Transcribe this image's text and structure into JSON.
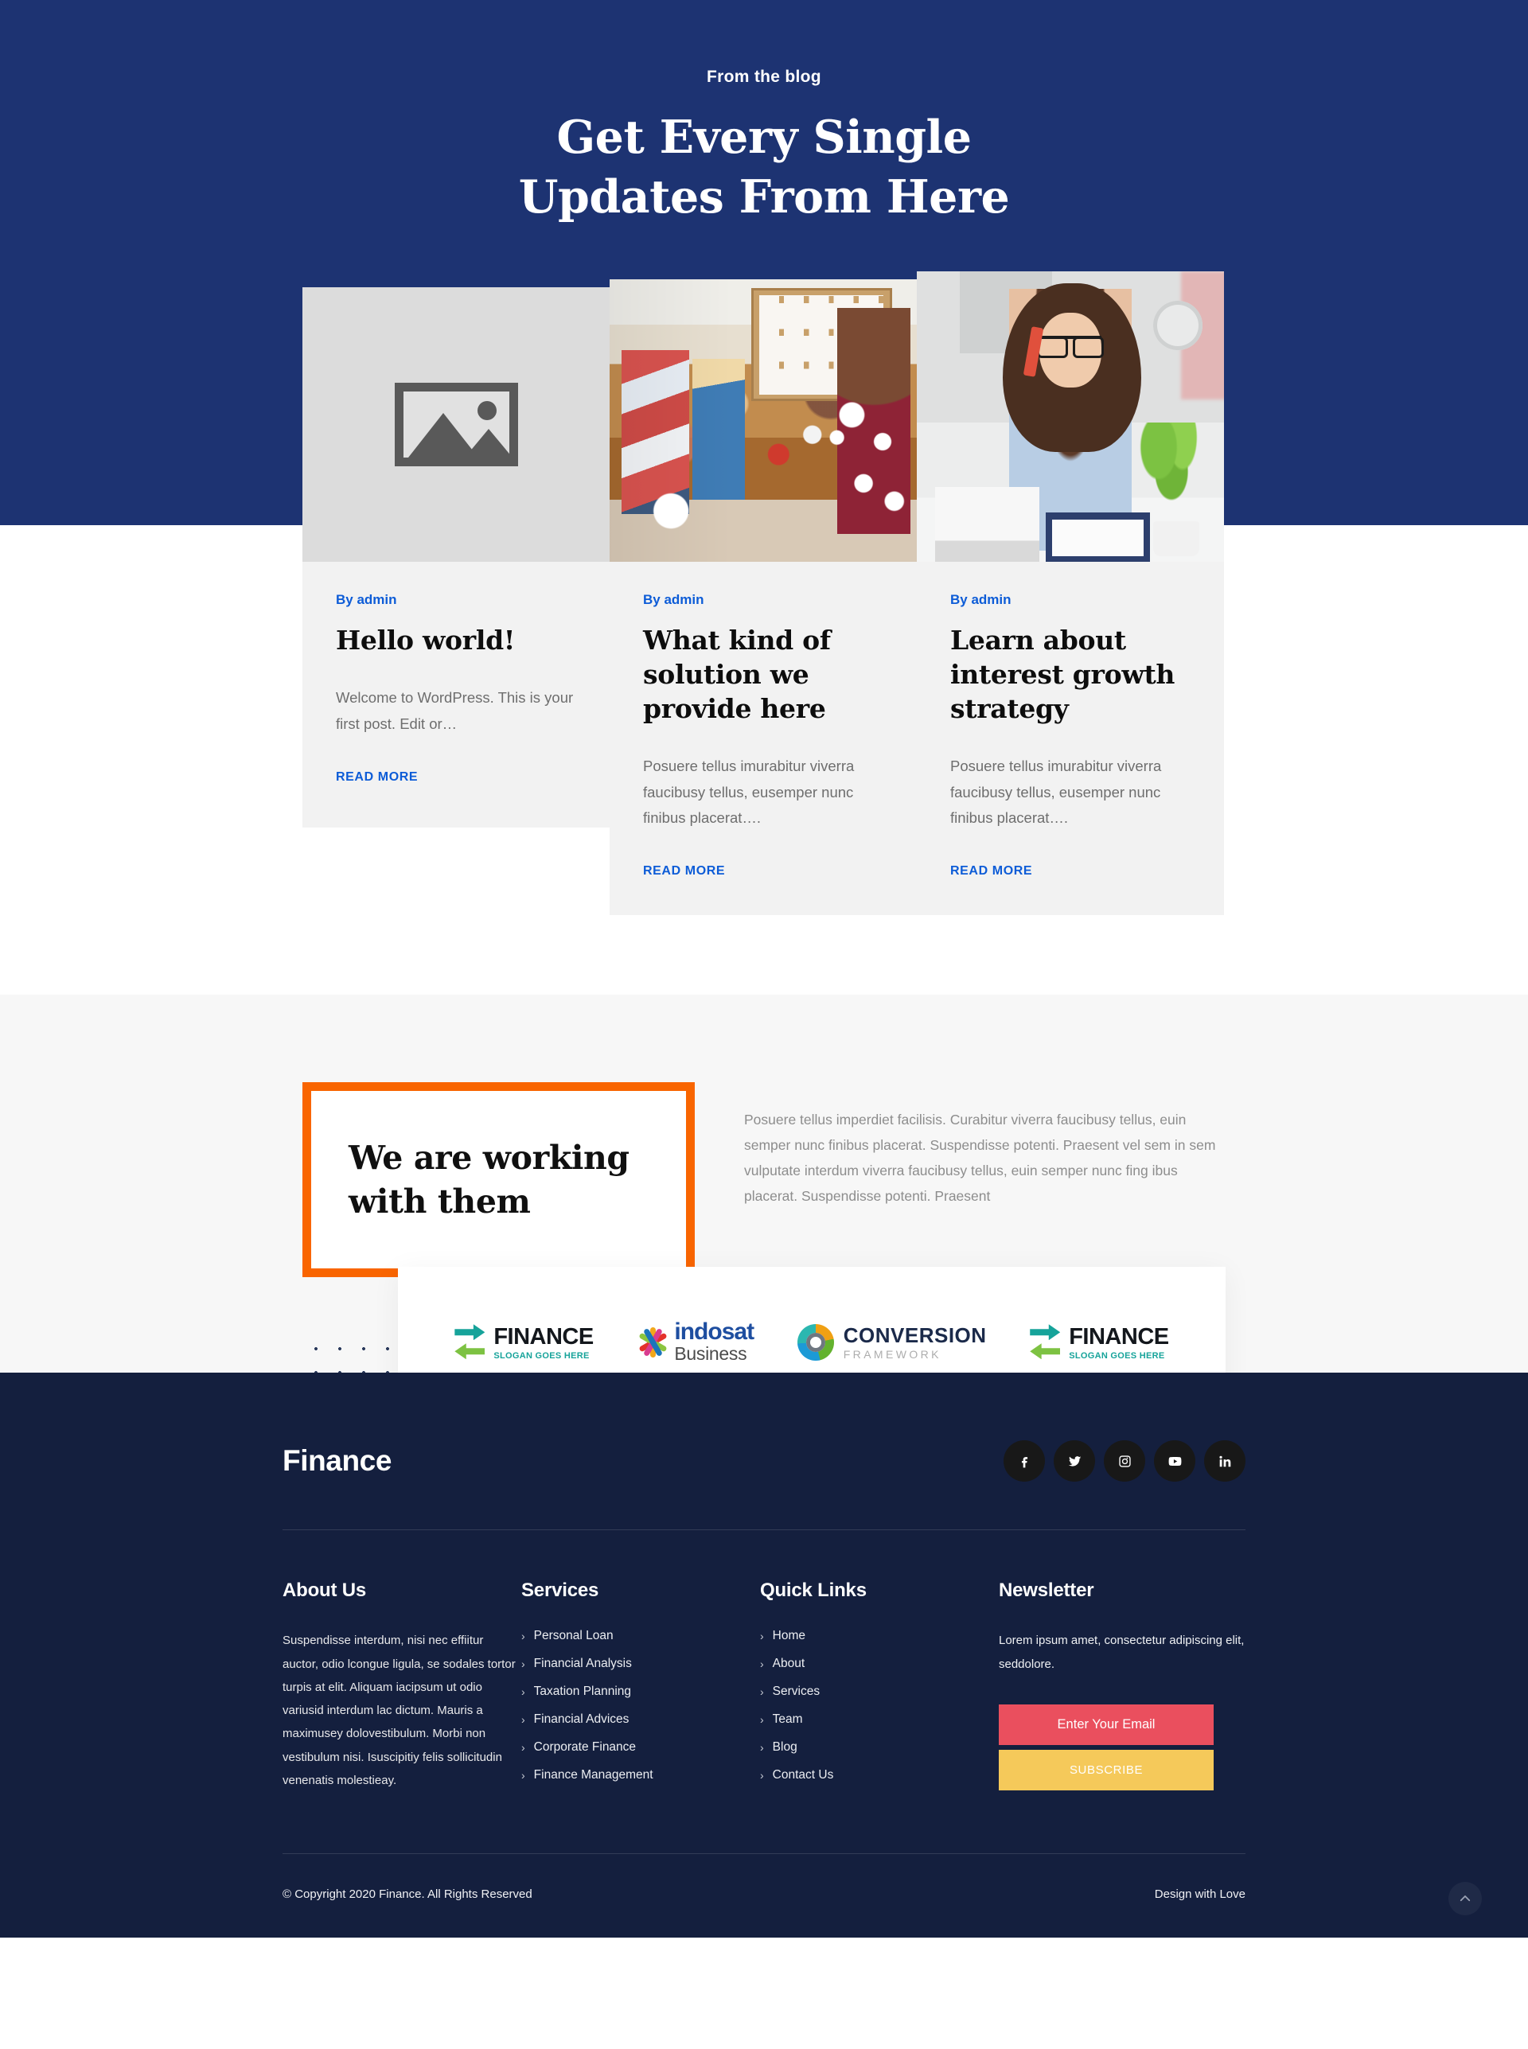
{
  "blog": {
    "eyebrow": "From the blog",
    "title_line1": "Get Every Single",
    "title_line2": "Updates From Here",
    "posts": [
      {
        "author": "By admin",
        "title": "Hello world!",
        "excerpt": "Welcome to WordPress. This is your first post. Edit or…",
        "read_more": "READ MORE",
        "media": "image-placeholder"
      },
      {
        "author": "By admin",
        "title": "What kind of solution we provide here",
        "excerpt": "Posuere tellus imurabitur viverra faucibusy tellus, eusemper nunc finibus placerat….",
        "read_more": "READ MORE",
        "media": "photo-team-meeting"
      },
      {
        "author": "By admin",
        "title": "Learn about interest growth strategy",
        "excerpt": "Posuere tellus imurabitur viverra faucibusy tellus, eusemper nunc finibus placerat….",
        "read_more": "READ MORE",
        "media": "photo-woman-on-phone"
      }
    ]
  },
  "partners": {
    "heading_line1": "We are working",
    "heading_line2": "with them",
    "paragraph": "Posuere tellus imperdiet facilisis. Curabitur viverra faucibusy tellus, euin semper nunc finibus placerat. Suspendisse potenti. Praesent vel sem in sem vulputate interdum viverra faucibusy tellus, euin semper nunc fing ibus placerat. Suspendisse potenti. Praesent",
    "logos": [
      {
        "name": "FINANCE",
        "slogan": "SLOGAN GOES HERE",
        "type": "finance"
      },
      {
        "name": "indosat",
        "slogan": "Business",
        "type": "indosat"
      },
      {
        "name": "CONVERSION",
        "slogan": "FRAMEWORK",
        "type": "conversion"
      },
      {
        "name": "FINANCE",
        "slogan": "SLOGAN GOES HERE",
        "type": "finance"
      }
    ]
  },
  "footer": {
    "brand": "Finance",
    "socials": [
      {
        "icon": "facebook-icon",
        "label": "Facebook"
      },
      {
        "icon": "twitter-icon",
        "label": "Twitter"
      },
      {
        "icon": "instagram-icon",
        "label": "Instagram"
      },
      {
        "icon": "youtube-icon",
        "label": "YouTube"
      },
      {
        "icon": "linkedin-icon",
        "label": "LinkedIn"
      }
    ],
    "about": {
      "heading": "About Us",
      "text": "Suspendisse interdum, nisi nec effiitur auctor, odio lcongue ligula, se sodales tortor turpis at elit. Aliquam iacipsum ut odio variusid interdum lac dictum. Mauris a maximusey dolovestibulum. Morbi non vestibulum nisi. Isuscipitiy felis sollicitudin venenatis molestieay."
    },
    "services": {
      "heading": "Services",
      "items": [
        "Personal Loan",
        "Financial Analysis",
        "Taxation Planning",
        "Financial Advices",
        "Corporate Finance",
        "Finance Management"
      ]
    },
    "quick_links": {
      "heading": "Quick Links",
      "items": [
        "Home",
        "About",
        "Services",
        "Team",
        "Blog",
        "Contact Us"
      ]
    },
    "newsletter": {
      "heading": "Newsletter",
      "text": "Lorem ipsum amet, consectetur adipiscing elit, seddolore.",
      "email_placeholder": "Enter Your Email",
      "email_value": "",
      "subscribe_label": "SUBSCRIBE"
    },
    "copyright": "© Copyright 2020 Finance. All Rights Reserved",
    "design_credit": "Design with Love",
    "back_to_top": "chevron-up-icon"
  },
  "colors": {
    "brand_blue": "#1d3372",
    "footer_navy": "#141f3e",
    "link_blue": "#0d5cd7",
    "accent_orange": "#f96500",
    "newsletter_red": "#ea4f5e",
    "subscribe_yellow": "#f5c95a",
    "card_gray": "#f2f2f2",
    "section_gray": "#f7f7f7"
  }
}
